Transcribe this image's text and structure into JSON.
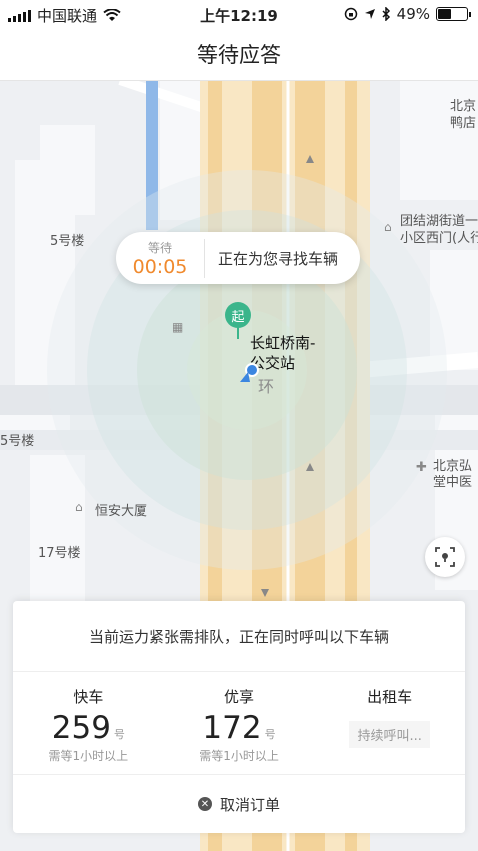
{
  "status": {
    "carrier": "中国联通",
    "time": "上午12:19",
    "battery": "49%",
    "battery_level": 0.49
  },
  "header": {
    "title": "等待应答"
  },
  "map": {
    "labels": [
      {
        "text": "北京",
        "key": "bj1"
      },
      {
        "text": "鸭店",
        "key": "yadian"
      },
      {
        "text": "5号楼",
        "key": "b5"
      },
      {
        "text": "团结湖街道一",
        "key": "tjh1"
      },
      {
        "text": "小区西门(人行",
        "key": "tjh2"
      },
      {
        "text": "5号楼",
        "key": "b5b"
      },
      {
        "text": "北京弘",
        "key": "bjh"
      },
      {
        "text": "堂中医",
        "key": "tzy"
      },
      {
        "text": "恒安大厦",
        "key": "hadx"
      },
      {
        "text": "17号楼",
        "key": "b17"
      },
      {
        "text": "环",
        "key": "huan"
      }
    ],
    "stop_name_line1": "长虹桥南-",
    "stop_name_line2": "公交站",
    "start_pin": "起"
  },
  "wait_bubble": {
    "label": "等待",
    "timer": "00:05",
    "message": "正在为您寻找车辆"
  },
  "card": {
    "notice": "当前运力紧张需排队，正在同时呼叫以下车辆",
    "options": [
      {
        "name": "快车",
        "count": "259",
        "unit": "号",
        "sub": "需等1小时以上"
      },
      {
        "name": "优享",
        "count": "172",
        "unit": "号",
        "sub": "需等1小时以上"
      },
      {
        "name": "出租车",
        "pending": "持续呼叫..."
      }
    ],
    "cancel_label": "取消订单"
  },
  "colors": {
    "accent_orange": "#f08a2e",
    "start_green": "#3bb58b",
    "location_blue": "#3b86e0"
  }
}
